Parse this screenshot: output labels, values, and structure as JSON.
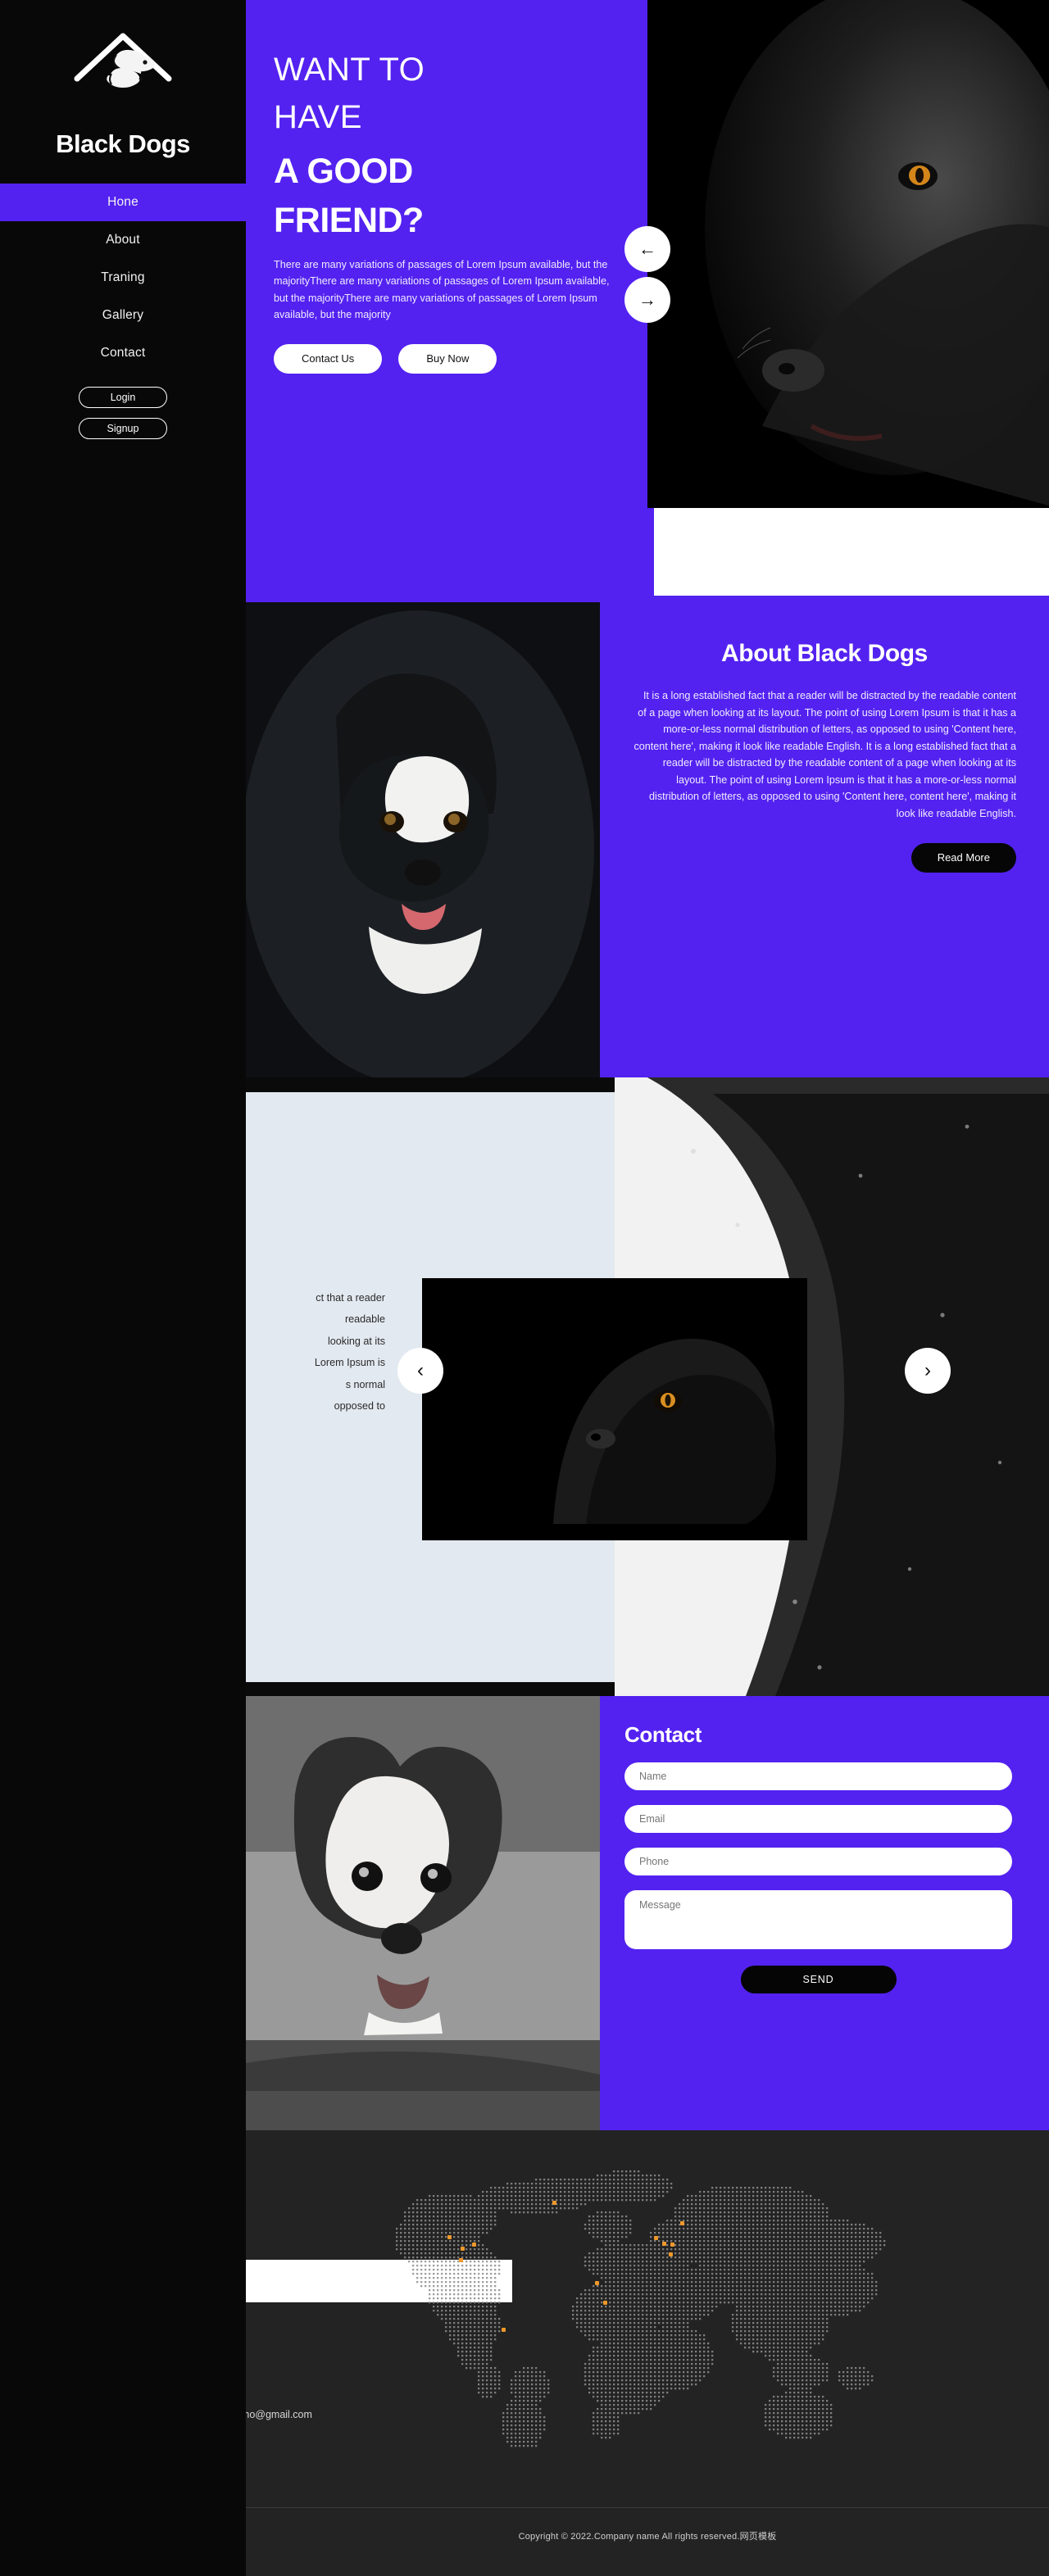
{
  "brand": {
    "name": "Black Dogs",
    "logo_icon": "dog-house-logo-icon"
  },
  "sidebar": {
    "items": [
      {
        "label": "Hone",
        "active": true
      },
      {
        "label": "About",
        "active": false
      },
      {
        "label": "Traning",
        "active": false
      },
      {
        "label": "Gallery",
        "active": false
      },
      {
        "label": "Contact",
        "active": false
      }
    ],
    "login_label": "Login",
    "signup_label": "Signup"
  },
  "hero": {
    "line1": "WANT TO",
    "line2": "HAVE",
    "headline1": "A GOOD",
    "headline2": "FRIEND?",
    "paragraph": "There are many variations of passages of Lorem Ipsum available, but the majorityThere are many variations of passages of Lorem Ipsum available, but the majorityThere are many variations of passages of Lorem Ipsum available, but the majority",
    "btn_contact": "Contact Us",
    "btn_buy": "Buy Now",
    "arrow_prev": "←",
    "arrow_next": "→"
  },
  "about": {
    "title": "About Black Dogs",
    "body": "It is a long established fact that a reader will be distracted by the readable content of a page when looking at its layout. The point of using Lorem Ipsum is that it has a more-or-less normal distribution of letters, as opposed to using 'Content here, content here', making it look like readable English. It is a long established fact that a reader will be distracted by the readable content of a page when looking at its layout. The point of using Lorem Ipsum is that it has a more-or-less normal distribution of letters, as opposed to using 'Content here, content here', making it look like readable English.",
    "read_more": "Read More"
  },
  "gallery": {
    "clipped_text": "ct that a reader\nreadable\nlooking at its\nLorem Ipsum is\ns normal\nopposed to",
    "arrow_prev": "‹",
    "arrow_next": "›"
  },
  "contact": {
    "title": "Contact",
    "name_placeholder": "Name",
    "email_placeholder": "Email",
    "phone_placeholder": "Phone",
    "message_placeholder": "Message",
    "send_label": "SEND"
  },
  "footer": {
    "email": "demo@gmail.com",
    "map_icon": "world-dot-map-icon",
    "marker_color": "#f0992a"
  },
  "copyright": {
    "text": "Copyright © 2022.Company name All rights reserved.网页模板"
  },
  "colors": {
    "accent_purple": "#5322f0",
    "sidebar_black": "#080808",
    "footer_gray": "#232323",
    "panel_light": "#e3e9f0",
    "marker_orange": "#f0992a"
  }
}
